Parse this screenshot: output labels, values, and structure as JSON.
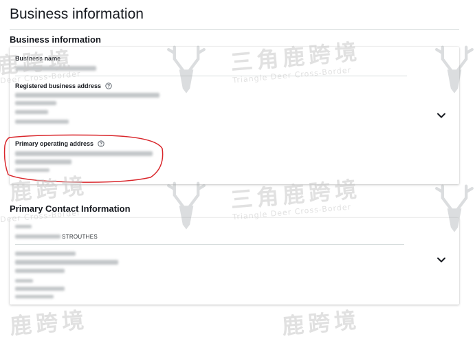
{
  "page": {
    "title": "Business information"
  },
  "business_section": {
    "heading": "Business information",
    "business_name_label": "Business name",
    "registered_address_label": "Registered business address",
    "primary_operating_label": "Primary operating address"
  },
  "contact_section": {
    "heading": "Primary Contact Information",
    "name_fragment": "STROUTHES"
  },
  "watermark": {
    "cn": "三角鹿跨境",
    "en": "Triangle Deer Cross-Border",
    "cn_partial": "鹿跨境",
    "en_partial": "Deer Cross-Border"
  },
  "colors": {
    "highlight": "#d9262b",
    "divider": "#d5dbdb",
    "text": "#16191f"
  },
  "icons": {
    "help": "question-circle-icon",
    "expand": "chevron-down-icon"
  }
}
